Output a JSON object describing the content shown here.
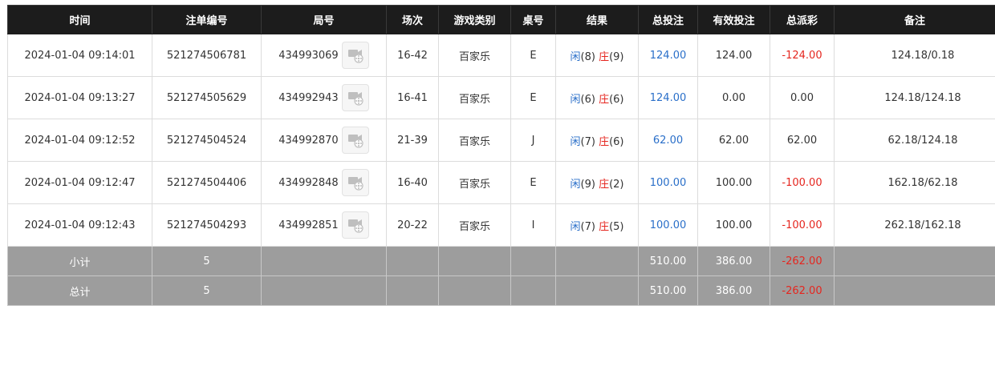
{
  "colors": {
    "header_bg": "#1c1c1c",
    "totals_bg": "#9d9d9d",
    "positive_blue": "#2a6fc9",
    "negative_red": "#e5261f"
  },
  "headers": {
    "time": "时间",
    "bet_no": "注单编号",
    "round": "局号",
    "session": "场次",
    "game_type": "游戏类别",
    "table": "桌号",
    "result": "结果",
    "total_bet": "总投注",
    "valid_bet": "有效投注",
    "payout": "总派彩",
    "note": "备注"
  },
  "rows": [
    {
      "time": "2024-01-04 09:14:01",
      "bet_no": "521274506781",
      "round": "434993069",
      "video_icon": "video-replay-icon",
      "session": "16-42",
      "game_type": "百家乐",
      "table": "E",
      "player_label": "闲",
      "player_score": "(8)",
      "banker_label": "庄",
      "banker_score": "(9)",
      "total_bet": "124.00",
      "valid_bet": "124.00",
      "payout": "-124.00",
      "note": "124.18/0.18"
    },
    {
      "time": "2024-01-04 09:13:27",
      "bet_no": "521274505629",
      "round": "434992943",
      "video_icon": "video-replay-icon",
      "session": "16-41",
      "game_type": "百家乐",
      "table": "E",
      "player_label": "闲",
      "player_score": "(6)",
      "banker_label": "庄",
      "banker_score": "(6)",
      "total_bet": "124.00",
      "valid_bet": "0.00",
      "payout": "0.00",
      "note": "124.18/124.18"
    },
    {
      "time": "2024-01-04 09:12:52",
      "bet_no": "521274504524",
      "round": "434992870",
      "video_icon": "video-replay-icon",
      "session": "21-39",
      "game_type": "百家乐",
      "table": "J",
      "player_label": "闲",
      "player_score": "(7)",
      "banker_label": "庄",
      "banker_score": "(6)",
      "total_bet": "62.00",
      "valid_bet": "62.00",
      "payout": "62.00",
      "note": "62.18/124.18"
    },
    {
      "time": "2024-01-04 09:12:47",
      "bet_no": "521274504406",
      "round": "434992848",
      "video_icon": "video-replay-icon",
      "session": "16-40",
      "game_type": "百家乐",
      "table": "E",
      "player_label": "闲",
      "player_score": "(9)",
      "banker_label": "庄",
      "banker_score": "(2)",
      "total_bet": "100.00",
      "valid_bet": "100.00",
      "payout": "-100.00",
      "note": "162.18/62.18"
    },
    {
      "time": "2024-01-04 09:12:43",
      "bet_no": "521274504293",
      "round": "434992851",
      "video_icon": "video-replay-icon",
      "session": "20-22",
      "game_type": "百家乐",
      "table": "I",
      "player_label": "闲",
      "player_score": "(7)",
      "banker_label": "庄",
      "banker_score": "(5)",
      "total_bet": "100.00",
      "valid_bet": "100.00",
      "payout": "-100.00",
      "note": "262.18/162.18"
    }
  ],
  "subtotal": {
    "label": "小计",
    "count": "5",
    "total_bet": "510.00",
    "valid_bet": "386.00",
    "payout": "-262.00"
  },
  "grand_total": {
    "label": "总计",
    "count": "5",
    "total_bet": "510.00",
    "valid_bet": "386.00",
    "payout": "-262.00"
  }
}
